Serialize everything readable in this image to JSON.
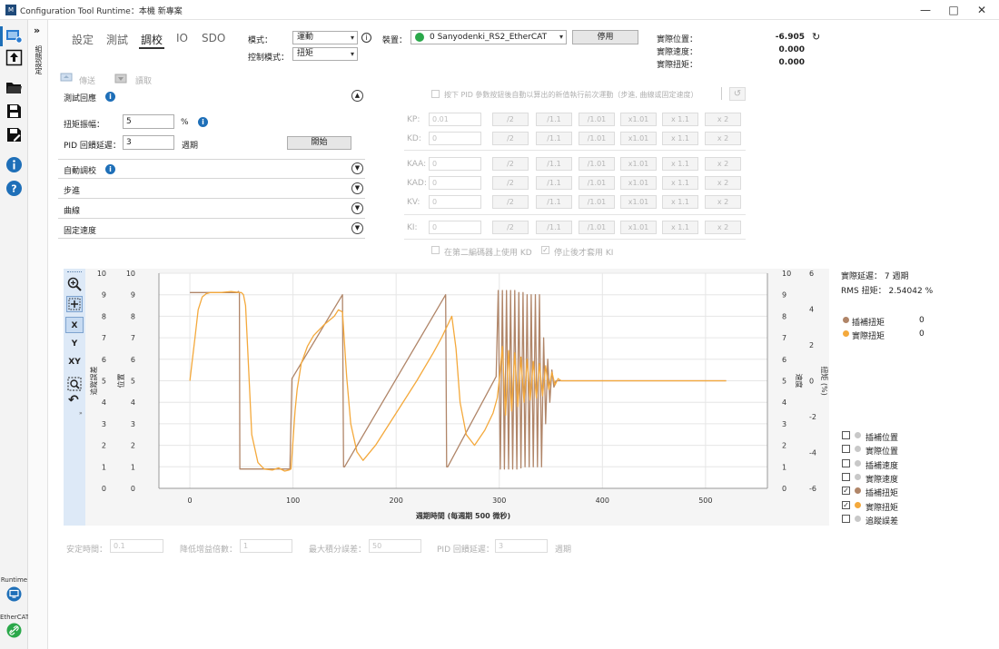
{
  "window": {
    "title": "Configuration Tool   Runtime：本機    新專案",
    "logo": "M"
  },
  "rail": {
    "runtime_label": "Runtime",
    "ethercat_label": "EtherCAT",
    "vertical_label": "組態設定"
  },
  "tabs": [
    {
      "label": "設定"
    },
    {
      "label": "測試"
    },
    {
      "label": "調校"
    },
    {
      "label": "IO"
    },
    {
      "label": "SDO"
    }
  ],
  "mode": {
    "label": "模式：",
    "value": "運動",
    "control_label": "控制模式：",
    "control_value": "扭矩"
  },
  "device": {
    "label": "裝置：",
    "value": "0 Sanyodenki_RS2_EtherCAT",
    "stop_button": "停用"
  },
  "status": {
    "position_label": "實際位置：",
    "position_value": "-6.905",
    "speed_label": "實際速度：",
    "speed_value": "0.000",
    "torque_label": "實際扭矩：",
    "torque_value": "0.000"
  },
  "actions": {
    "send": "傳送",
    "read": "讀取"
  },
  "test_response": {
    "title": "測試回應",
    "amplitude_label": "扭矩振幅：",
    "amplitude_value": "5",
    "amplitude_unit": "%",
    "delay_label": "PID 回饋延遲：",
    "delay_value": "3",
    "delay_unit": "週期",
    "start_button": "開始"
  },
  "sections": [
    "自動調校",
    "步進",
    "曲線",
    "固定速度"
  ],
  "pid": {
    "hint": "按下 PID 參數按鈕後自動以算出的新值執行前次運動（步進, 曲線或固定速度）",
    "rows": [
      {
        "label": "KP:",
        "value": "0.01"
      },
      {
        "label": "KD:",
        "value": "0"
      },
      {
        "label": "KAA:",
        "value": "0"
      },
      {
        "label": "KAD:",
        "value": "0"
      },
      {
        "label": "KV:",
        "value": "0"
      },
      {
        "label": "KI:",
        "value": "0"
      }
    ],
    "buttons": [
      "/2",
      "/1.1",
      "/1.01",
      "x1.01",
      "x 1.1",
      "x 2"
    ],
    "kd_second_encoder": "在第二編碼器上使用 KD",
    "ki_after_stop": "停止後才套用 KI"
  },
  "results": {
    "delay_label": "實際延遲：",
    "delay_value": "7",
    "delay_unit": "週期",
    "rms_label": "RMS 扭矩：",
    "rms_value": "2.54042",
    "rms_unit": "%"
  },
  "legend_values": [
    {
      "name": "插補扭矩",
      "value": "0",
      "color": "#b08568"
    },
    {
      "name": "實際扭矩",
      "value": "0",
      "color": "#f4a93c"
    }
  ],
  "checklist": [
    {
      "name": "插補位置",
      "checked": false,
      "color": "#c8c8c8"
    },
    {
      "name": "實際位置",
      "checked": false,
      "color": "#c8c8c8"
    },
    {
      "name": "插補速度",
      "checked": false,
      "color": "#c8c8c8"
    },
    {
      "name": "實際速度",
      "checked": false,
      "color": "#c8c8c8"
    },
    {
      "name": "插補扭矩",
      "checked": true,
      "color": "#b08568"
    },
    {
      "name": "實際扭矩",
      "checked": true,
      "color": "#f4a93c"
    },
    {
      "name": "追蹤誤差",
      "checked": false,
      "color": "#c8c8c8"
    }
  ],
  "plot_tools": {
    "x": "X",
    "y": "Y",
    "xy": "XY"
  },
  "footer": {
    "settle_label": "安定時間：",
    "settle_value": "0.1",
    "gain_label": "降低增益倍數：",
    "gain_value": "1",
    "error_label": "最大積分誤差：",
    "error_value": "50",
    "delay_label": "PID 回饋延遲：",
    "delay_value": "3",
    "delay_unit": "週期"
  },
  "chart_data": {
    "type": "line",
    "xlabel": "週期時間 (每週期 500 微秒)",
    "left_axes": [
      "追蹤誤差",
      "位置"
    ],
    "right_axes": [
      "速度",
      "扭矩 (%)"
    ],
    "xlim": [
      -30,
      560
    ],
    "xticks": [
      0,
      100,
      200,
      300,
      400,
      500
    ],
    "ylim": [
      0,
      10
    ],
    "yticks": [
      0,
      1,
      2,
      3,
      4,
      5,
      6,
      7,
      8,
      9,
      10
    ],
    "y2lim": [
      -6,
      6
    ],
    "y2ticks": [
      -6,
      -4,
      -2,
      0,
      2,
      4,
      6
    ],
    "series": [
      {
        "name": "插補扭矩",
        "color": "#b08568",
        "x": [
          0,
          2,
          4,
          46,
          47,
          48,
          48.5,
          49,
          93,
          95,
          97,
          99,
          148,
          149,
          150,
          248,
          249,
          250,
          297,
          299,
          301,
          303,
          305,
          307,
          309,
          311,
          313,
          315,
          317,
          319,
          321,
          323,
          325,
          327,
          329,
          331,
          333,
          335,
          337,
          339,
          341,
          343,
          345,
          347,
          349,
          351,
          353,
          355,
          360,
          400,
          450,
          520
        ],
        "y": [
          9.1,
          9.1,
          9.1,
          9.1,
          9.15,
          9.1,
          0.9,
          0.9,
          0.9,
          0.9,
          0.9,
          5.1,
          9,
          1,
          1,
          9,
          1,
          1,
          5.2,
          9.2,
          0.9,
          9.2,
          0.9,
          9.2,
          0.9,
          9.2,
          0.9,
          9.2,
          0.9,
          9.1,
          0.95,
          9.1,
          1,
          9,
          1,
          9,
          1,
          9,
          1,
          9,
          1,
          7,
          3,
          6,
          4,
          5.5,
          4.7,
          5,
          5,
          5,
          5,
          5
        ]
      },
      {
        "name": "實際扭矩",
        "color": "#f4a93c",
        "x": [
          0,
          2,
          5,
          8,
          12,
          16,
          20,
          30,
          40,
          48,
          50,
          52,
          54,
          56,
          60,
          66,
          72,
          80,
          86,
          92,
          96,
          98,
          100,
          102,
          104,
          108,
          114,
          120,
          130,
          140,
          144,
          148,
          152,
          156,
          162,
          168,
          180,
          200,
          220,
          236,
          244,
          250,
          254,
          258,
          262,
          268,
          276,
          286,
          294,
          298,
          300,
          303,
          306,
          309,
          312,
          315,
          318,
          321,
          324,
          327,
          330,
          333,
          336,
          339,
          342,
          345,
          348,
          351,
          354,
          357,
          360,
          400,
          450,
          520
        ],
        "y": [
          5,
          5.8,
          7,
          8.3,
          8.9,
          9.05,
          9.1,
          9.1,
          9.15,
          9.1,
          9.1,
          9.0,
          8.5,
          6.5,
          2.5,
          1.2,
          0.9,
          0.85,
          0.95,
          0.8,
          0.85,
          0.9,
          2.2,
          3.6,
          4.6,
          5.8,
          6.6,
          7.1,
          7.6,
          8.0,
          8.3,
          8.2,
          5.2,
          3.0,
          1.7,
          1.3,
          2.0,
          3.5,
          5.0,
          6.3,
          7.0,
          7.6,
          8.0,
          6.5,
          4.0,
          2.5,
          2.0,
          2.7,
          3.5,
          4.2,
          5.0,
          6.6,
          3.4,
          6.4,
          3.6,
          6.3,
          3.8,
          6.1,
          4.0,
          6.0,
          4.1,
          5.9,
          4.2,
          5.8,
          4.3,
          5.7,
          4.6,
          5.4,
          4.8,
          5.1,
          5.0,
          5.0,
          5.0,
          5.0
        ]
      }
    ]
  }
}
